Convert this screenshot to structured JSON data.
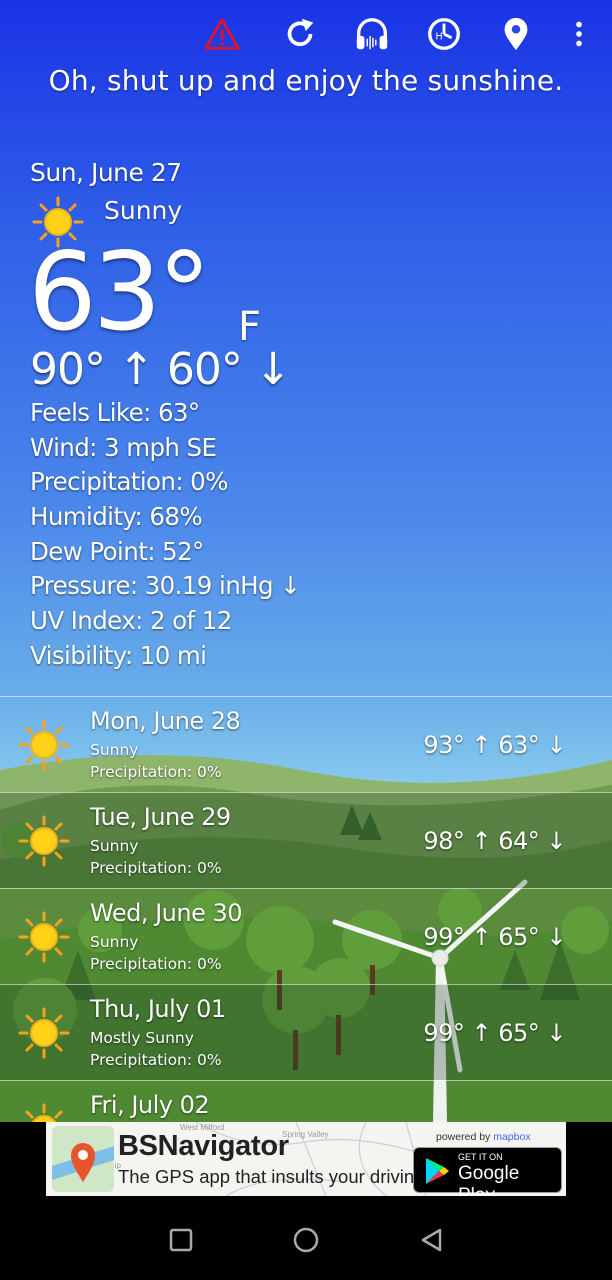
{
  "toolbar": {
    "icons": [
      "warning-icon",
      "refresh-icon",
      "headphones-icon",
      "hourly-clock-icon",
      "location-pin-icon",
      "more-vert-icon"
    ]
  },
  "tagline": "Oh, shut up and enjoy the sunshine.",
  "current": {
    "date": "Sun, June 27",
    "condition": "Sunny",
    "temp": "63°",
    "unit": "F",
    "hilo": "90° ↑  60° ↓",
    "details": [
      "Feels Like: 63°",
      "Wind: 3 mph SE",
      "Precipitation: 0%",
      "Humidity: 68%",
      "Dew Point: 52°",
      "Pressure: 30.19 inHg ↓",
      "UV Index: 2 of 12",
      "Visibility: 10 mi"
    ]
  },
  "forecast": [
    {
      "date": "Mon, June 28",
      "condition": "Sunny",
      "precip": "Precipitation: 0%",
      "temps": "93° ↑  63° ↓"
    },
    {
      "date": "Tue, June 29",
      "condition": "Sunny",
      "precip": "Precipitation: 0%",
      "temps": "98° ↑  64° ↓"
    },
    {
      "date": "Wed, June 30",
      "condition": "Sunny",
      "precip": "Precipitation: 0%",
      "temps": "99° ↑  65° ↓"
    },
    {
      "date": "Thu, July 01",
      "condition": "Mostly Sunny",
      "precip": "Precipitation: 0%",
      "temps": "99° ↑  65° ↓"
    },
    {
      "date": "Fri, July 02",
      "condition": "",
      "precip": "",
      "temps": ""
    }
  ],
  "ad": {
    "title": "BSNavigator",
    "subtitle": "The GPS app that insults your driving.",
    "powered_by": "powered by",
    "mapbox": "mapbox",
    "store_small": "GET IT ON",
    "store_big": "Google Play",
    "map_labels": [
      "West Milford",
      "Spring Valley",
      "wnship"
    ]
  },
  "colors": {
    "warning": "#e0132b",
    "sun": "#ffd21a",
    "sun_ray": "#f6a21a"
  }
}
